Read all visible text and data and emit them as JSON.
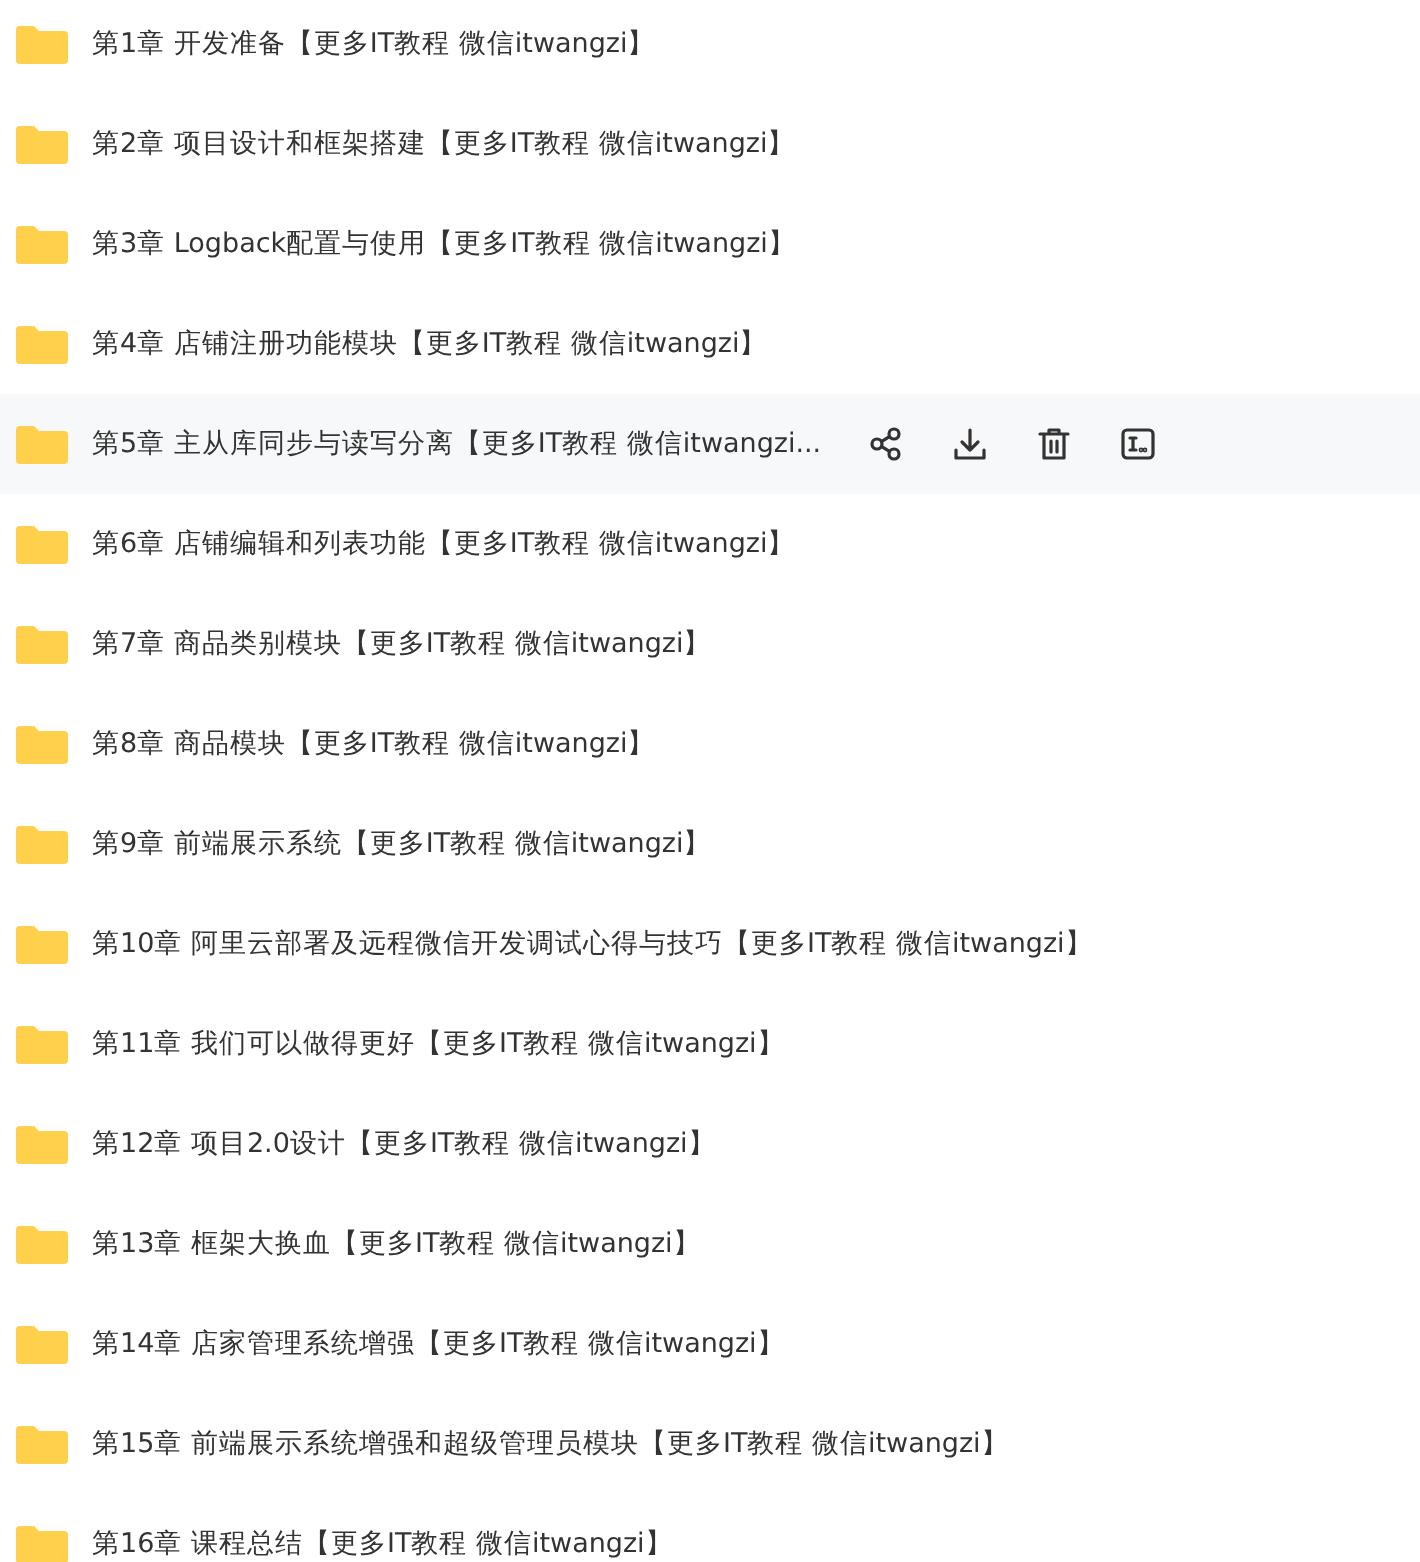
{
  "folders": [
    {
      "name": "第1章 开发准备【更多IT教程 微信itwangzi】",
      "hovered": false
    },
    {
      "name": "第2章 项目设计和框架搭建【更多IT教程 微信itwangzi】",
      "hovered": false
    },
    {
      "name": "第3章 Logback配置与使用【更多IT教程 微信itwangzi】",
      "hovered": false
    },
    {
      "name": "第4章 店铺注册功能模块【更多IT教程 微信itwangzi】",
      "hovered": false
    },
    {
      "name": "第5章 主从库同步与读写分离【更多IT教程 微信itwangzi...",
      "hovered": true
    },
    {
      "name": "第6章 店铺编辑和列表功能【更多IT教程 微信itwangzi】",
      "hovered": false
    },
    {
      "name": "第7章 商品类别模块【更多IT教程 微信itwangzi】",
      "hovered": false
    },
    {
      "name": "第8章 商品模块【更多IT教程 微信itwangzi】",
      "hovered": false
    },
    {
      "name": "第9章 前端展示系统【更多IT教程 微信itwangzi】",
      "hovered": false
    },
    {
      "name": "第10章 阿里云部署及远程微信开发调试心得与技巧【更多IT教程 微信itwangzi】",
      "hovered": false
    },
    {
      "name": "第11章 我们可以做得更好【更多IT教程 微信itwangzi】",
      "hovered": false
    },
    {
      "name": "第12章 项目2.0设计【更多IT教程 微信itwangzi】",
      "hovered": false
    },
    {
      "name": "第13章 框架大换血【更多IT教程 微信itwangzi】",
      "hovered": false
    },
    {
      "name": "第14章 店家管理系统增强【更多IT教程 微信itwangzi】",
      "hovered": false
    },
    {
      "name": "第15章 前端展示系统增强和超级管理员模块【更多IT教程 微信itwangzi】",
      "hovered": false
    },
    {
      "name": "第16章 课程总结【更多IT教程 微信itwangzi】",
      "hovered": false
    }
  ]
}
